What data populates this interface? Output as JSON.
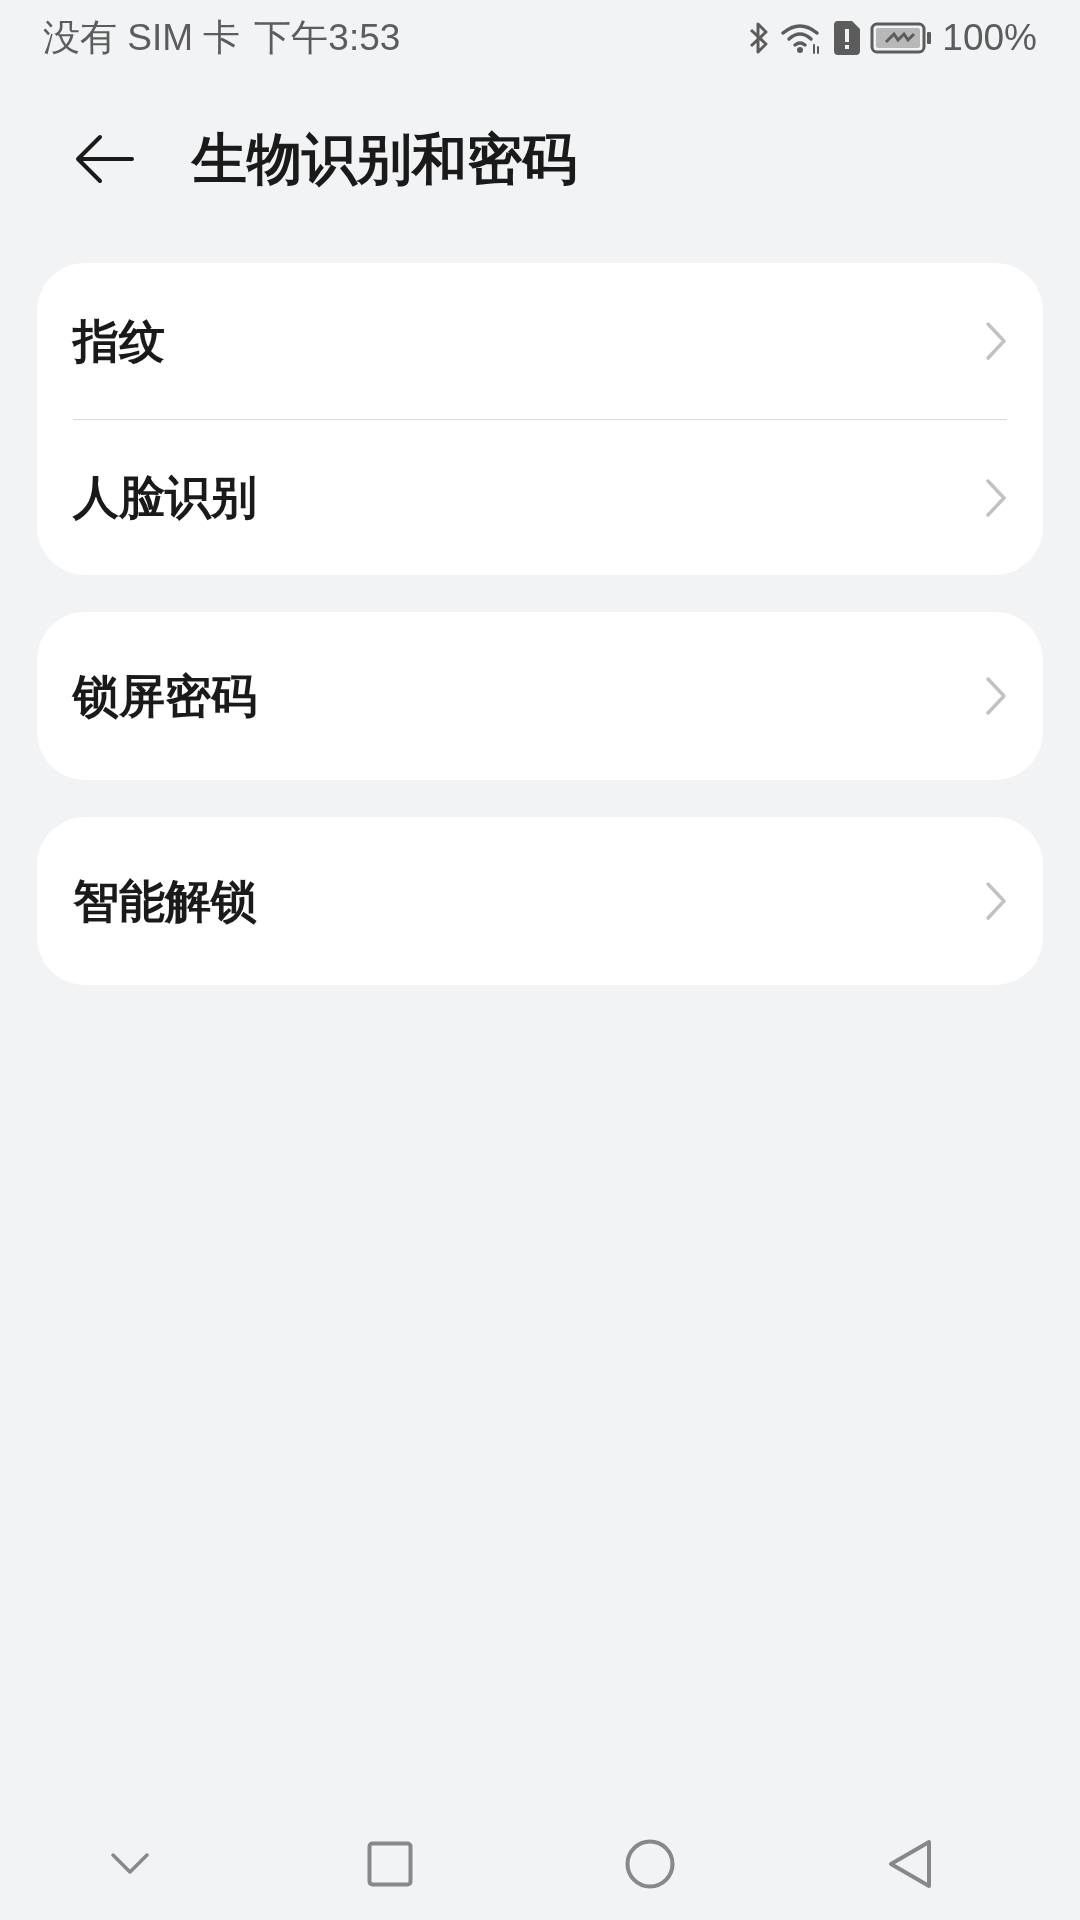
{
  "status_bar": {
    "carrier": "没有 SIM 卡",
    "time": "下午3:53",
    "battery": "100%"
  },
  "header": {
    "title": "生物识别和密码"
  },
  "groups": [
    {
      "items": [
        {
          "label": "指纹"
        },
        {
          "label": "人脸识别"
        }
      ]
    },
    {
      "items": [
        {
          "label": "锁屏密码"
        }
      ]
    },
    {
      "items": [
        {
          "label": "智能解锁"
        }
      ]
    }
  ]
}
